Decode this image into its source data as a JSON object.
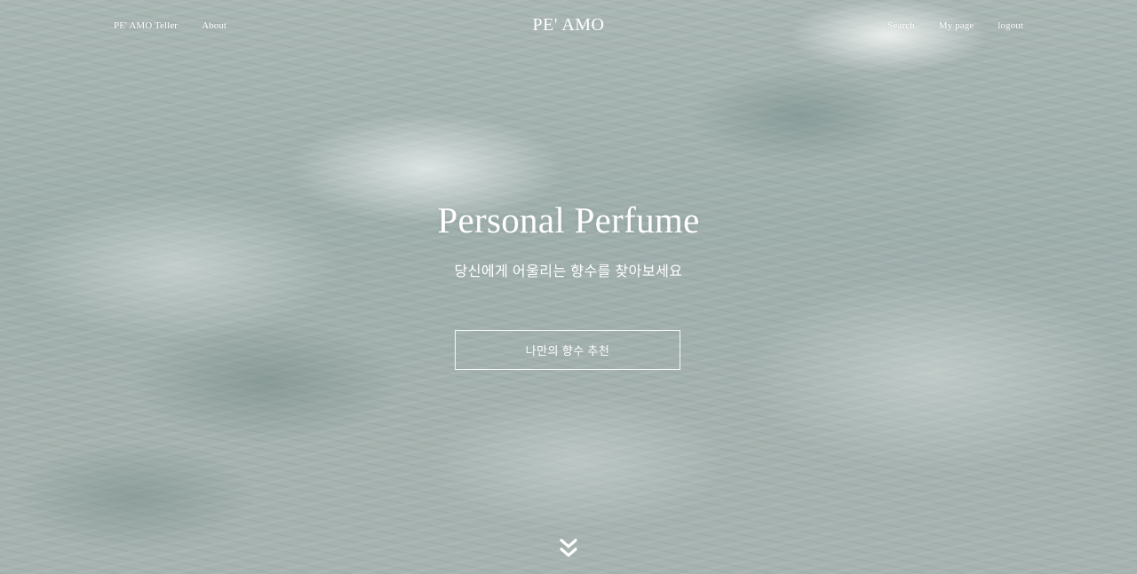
{
  "nav": {
    "left": [
      {
        "label": "PE' AMO Teller"
      },
      {
        "label": "About"
      }
    ],
    "logo": "PE' AMO",
    "right": [
      {
        "label": "Search"
      },
      {
        "label": "My page"
      },
      {
        "label": "logout"
      }
    ]
  },
  "hero": {
    "headline": "Personal Perfume",
    "subtitle": "당신에게 어울리는 향수를 찾아보세요",
    "cta_label": "나만의 향수 추천",
    "scroll_icon": "double-chevron-down-icon"
  },
  "colors": {
    "text": "#ffffff",
    "background": "#9eaeab"
  }
}
